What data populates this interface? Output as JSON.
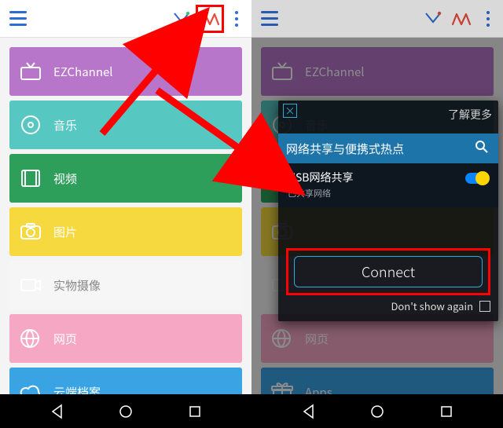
{
  "topbar": {
    "menu_name": "menu-icon",
    "v_name": "v-icon",
    "w_name": "w-icon",
    "dots_name": "more-icon"
  },
  "tiles": [
    {
      "label": "EZChannel",
      "color": "#b776c9",
      "icon": "tv-icon"
    },
    {
      "label": "音乐",
      "color": "#57c7c1",
      "icon": "music-icon"
    },
    {
      "label": "视频",
      "color": "#2e9e5b",
      "icon": "video-icon"
    },
    {
      "label": "图片",
      "color": "#f5d93f",
      "icon": "photo-icon"
    },
    {
      "label": "实物摄像",
      "color": "#f6f6f6",
      "icon": "camera-icon",
      "text_color": "#888"
    },
    {
      "label": "网页",
      "color": "#f5a7c3",
      "icon": "web-icon"
    },
    {
      "label": "云端档案",
      "color": "#3aa3e3",
      "icon": "cloud-icon"
    }
  ],
  "right": {
    "card": {
      "close": "×",
      "learn_more": "了解更多",
      "search_label": "网络共享与便携式热点",
      "setting_title": "USB网络共享",
      "setting_sub": "已共享网络",
      "connect_label": "Connect",
      "dont_show": "Don't show again"
    },
    "tiles": [
      {
        "label": "EZChannel",
        "color": "#b776c9",
        "icon": "tv-icon"
      },
      {
        "label": "音乐",
        "color": "#57c7c1",
        "icon": "music-icon"
      },
      {
        "label": "",
        "color": "#2e9e5b",
        "icon": "video-icon"
      },
      {
        "label": "",
        "color": "#f5d93f",
        "icon": "photo-icon"
      },
      {
        "label": "",
        "color": "#f6f6f6",
        "icon": "camera-icon",
        "text_color": "#888"
      },
      {
        "label": "网页",
        "color": "#f5a7c3",
        "icon": "web-icon"
      },
      {
        "label": "Apps",
        "color": "#3aa3e3",
        "icon": "gift-icon"
      }
    ]
  }
}
